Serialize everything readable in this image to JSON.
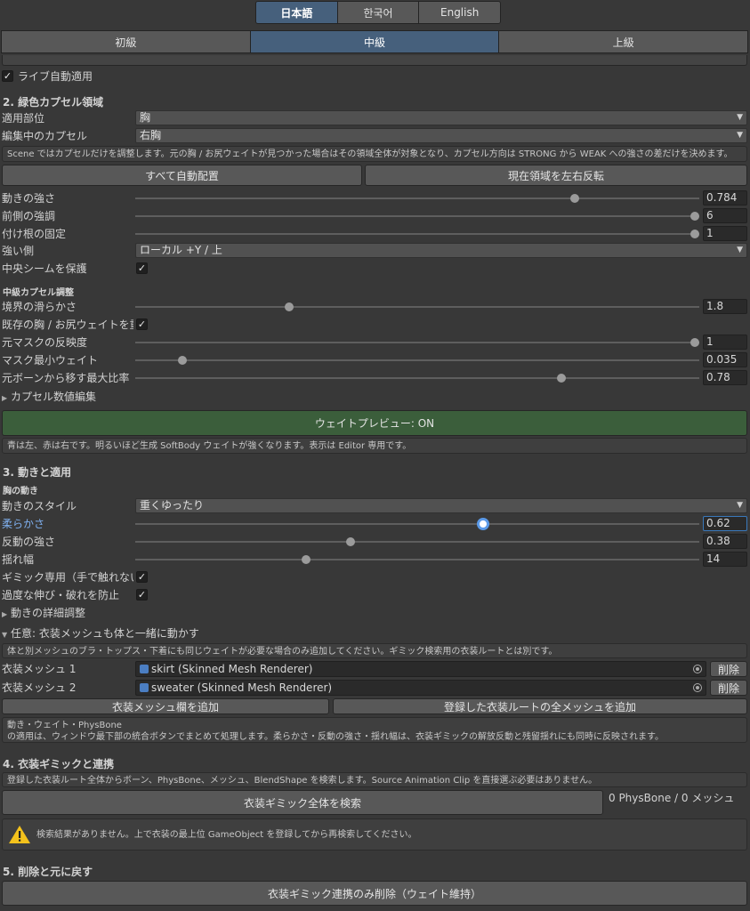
{
  "languages": [
    "日本語",
    "한국어",
    "English"
  ],
  "tabs": [
    "初級",
    "中級",
    "上級"
  ],
  "live_apply": "ライブ自動適用",
  "sec2": {
    "title": "2. 緑色カプセル領域",
    "part_label": "適用部位",
    "part_value": "胸",
    "capsule_label": "編集中のカプセル",
    "capsule_value": "右胸",
    "help": "Scene ではカプセルだけを調整します。元の胸 / お尻ウェイトが見つかった場合はその領域全体が対象となり、カプセル方向は STRONG から WEAK への強さの差だけを決めます。",
    "auto_btn": "すべて自動配置",
    "mirror_btn": "現在領域を左右反転",
    "sliders": [
      {
        "label": "動きの強さ",
        "value": "0.784",
        "fraction": 0.784
      },
      {
        "label": "前側の強調",
        "value": "6",
        "fraction": 1.0
      },
      {
        "label": "付け根の固定",
        "value": "1",
        "fraction": 1.0
      }
    ],
    "strong_label": "強い側",
    "strong_value": "ローカル +Y / 上",
    "center_label": "中央シームを保護",
    "mid_title": "中級カプセル調整",
    "mid_sliders": [
      {
        "label": "境界の滑らかさ",
        "value": "1.8",
        "fraction": 0.27
      },
      {
        "label": "既存の胸 / お尻ウェイトを重視",
        "value": "",
        "fraction": null
      },
      {
        "label": "元マスクの反映度",
        "value": "1",
        "fraction": 1.0
      },
      {
        "label": "マスク最小ウェイト",
        "value": "0.035",
        "fraction": 0.077
      },
      {
        "label": "元ボーンから移す最大比率",
        "value": "0.78",
        "fraction": 0.76
      }
    ],
    "capsule_edit": "カプセル数値編集",
    "preview_btn": "ウェイトプレビュー: ON",
    "preview_help": "青は左、赤は右です。明るいほど生成 SoftBody ウェイトが強くなります。表示は Editor 専用です。"
  },
  "sec3": {
    "title": "3. 動きと適用",
    "sub": "胸の動き",
    "style_label": "動きのスタイル",
    "style_value": "重くゆったり",
    "sliders": [
      {
        "label": "柔らかさ",
        "value": "0.62",
        "fraction": 0.62
      },
      {
        "label": "反動の強さ",
        "value": "0.38",
        "fraction": 0.38
      },
      {
        "label": "揺れ幅",
        "value": "14",
        "fraction": 0.3
      }
    ],
    "gimmick_label": "ギミック専用（手で触れない）",
    "stretch_label": "過度な伸び・破れを防止",
    "detail": "動きの詳細調整",
    "optional": "任意: 衣装メッシュも体と一緒に動かす",
    "optional_help": "体と別メッシュのブラ・トップス・下着にも同じウェイトが必要な場合のみ追加してください。ギミック検索用の衣装ルートとは別です。",
    "meshes": [
      {
        "label": "衣装メッシュ 1",
        "value": "skirt (Skinned Mesh Renderer)",
        "remove": "削除"
      },
      {
        "label": "衣装メッシュ 2",
        "value": "sweater (Skinned Mesh Renderer)",
        "remove": "削除"
      }
    ],
    "add_mesh_btn": "衣装メッシュ欄を追加",
    "add_all_btn": "登録した衣装ルートの全メッシュを追加",
    "apply_help_1": "動き・ウェイト・PhysBone",
    "apply_help_2": "の適用は、ウィンドウ最下部の統合ボタンでまとめて処理します。柔らかさ・反動の強さ・揺れ幅は、衣装ギミックの解放反動と残留揺れにも同時に反映されます。"
  },
  "sec4": {
    "title": "4. 衣装ギミックと連携",
    "help": "登録した衣装ルート全体からボーン、PhysBone、メッシュ、BlendShape を検索します。Source Animation Clip を直接選ぶ必要はありません。",
    "search_btn": "衣装ギミック全体を検索",
    "count": "0 PhysBone / 0 メッシュ",
    "warning": "検索結果がありません。上で衣装の最上位 GameObject を登録してから再検索してください。"
  },
  "sec5": {
    "title": "5. 削除と元に戻す",
    "delete_btn": "衣装ギミック連携のみ削除（ウェイト維持）"
  },
  "colors": {
    "accent": "#46607c",
    "preview": "#3b5e3b",
    "focus": "#5b9ae8"
  }
}
